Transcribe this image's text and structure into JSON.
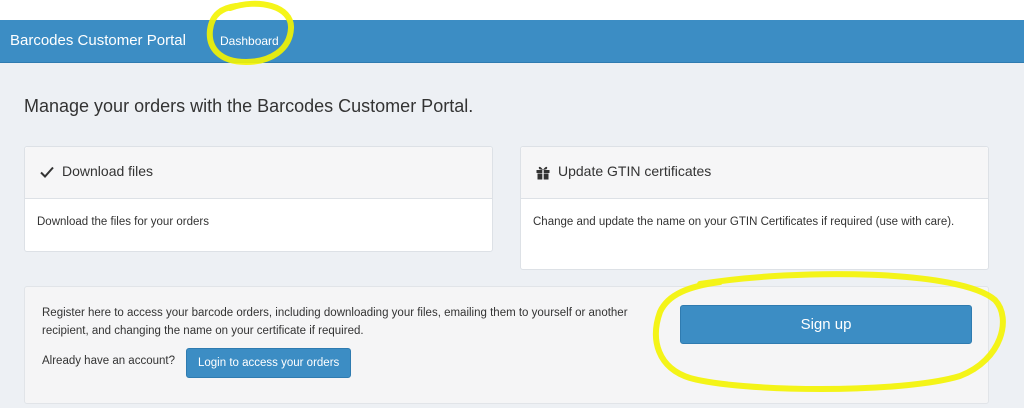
{
  "navbar": {
    "brand": "Barcodes Customer Portal",
    "links": [
      {
        "label": "Dashboard"
      }
    ]
  },
  "main": {
    "heading": "Manage your orders with the Barcodes Customer Portal.",
    "panels": [
      {
        "title": "Download files",
        "icon": "check-icon",
        "body": "Download the files for your orders"
      },
      {
        "title": "Update GTIN certificates",
        "icon": "gift-icon",
        "body": "Change and update the name on your GTIN Certificates if required (use with care)."
      }
    ],
    "register": {
      "text": "Register here to access your barcode orders, including downloading your files, emailing them to yourself or another recipient, and changing the name on your certificate if required.",
      "already_label": "Already have an account?",
      "login_label": "Login to access your orders",
      "signup_label": "Sign up"
    }
  },
  "annotations": {
    "highlight_color": "#f4f400"
  },
  "colors": {
    "navbar": "#3c8dc4",
    "button": "#3c8dc4",
    "background": "#edf0f4"
  }
}
